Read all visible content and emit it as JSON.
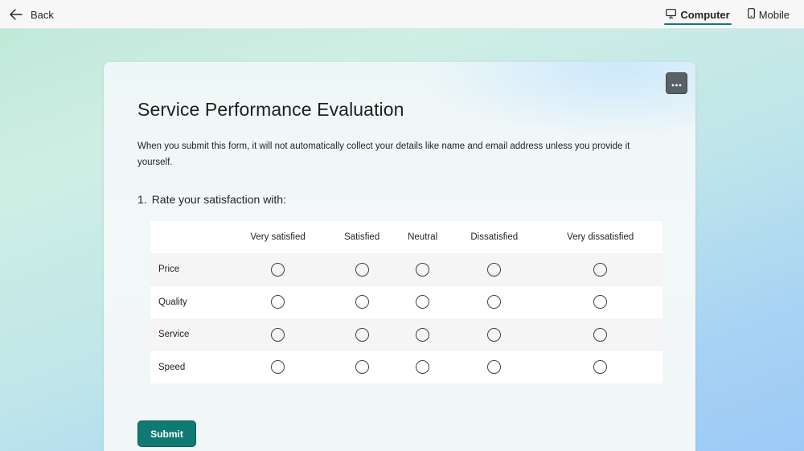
{
  "topbar": {
    "back_label": "Back",
    "views": [
      {
        "label": "Computer",
        "active": true,
        "icon": "monitor-icon"
      },
      {
        "label": "Mobile",
        "active": false,
        "icon": "phone-icon"
      }
    ]
  },
  "form": {
    "title": "Service Performance Evaluation",
    "description": "When you submit this form, it will not automatically collect your details like name and email address unless you provide it yourself.",
    "more_icon": "ellipsis-icon",
    "question": {
      "number": "1.",
      "text": "Rate your satisfaction with:",
      "columns": [
        "Very satisfied",
        "Satisfied",
        "Neutral",
        "Dissatisfied",
        "Very dissatisfied"
      ],
      "rows": [
        "Price",
        "Quality",
        "Service",
        "Speed"
      ]
    },
    "submit_label": "Submit"
  },
  "colors": {
    "accent": "#0e7a73",
    "topbar_bg": "#f7f7f7"
  }
}
